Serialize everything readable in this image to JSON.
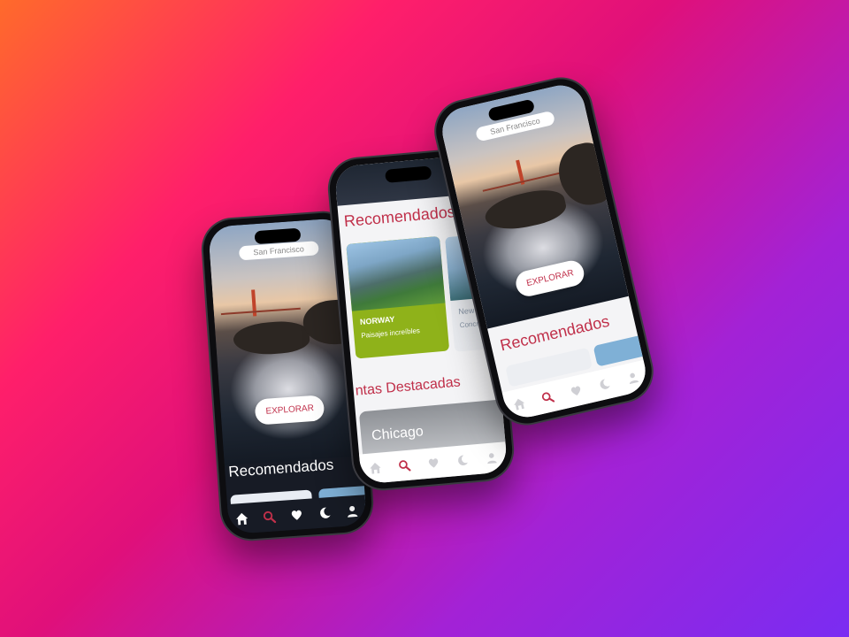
{
  "colors": {
    "accent": "#c0304a",
    "card_green": "#8fb21a",
    "nav_dark": "#171b25"
  },
  "home": {
    "location": "San Francisco",
    "explore_label": "EXPLORAR",
    "recommended_title": "Recomendados"
  },
  "discover": {
    "recommended_title": "Recomendados",
    "cards": [
      {
        "title": "NORWAY",
        "subtitle": "Paisajes increíbles"
      },
      {
        "title": "New Yo",
        "subtitle": "Concret"
      }
    ],
    "featured_title": "ntas Destacadas",
    "featured_city": "Chicago"
  },
  "nav_icons": [
    "home-icon",
    "search-icon",
    "heart-icon",
    "moon-icon",
    "user-icon"
  ]
}
